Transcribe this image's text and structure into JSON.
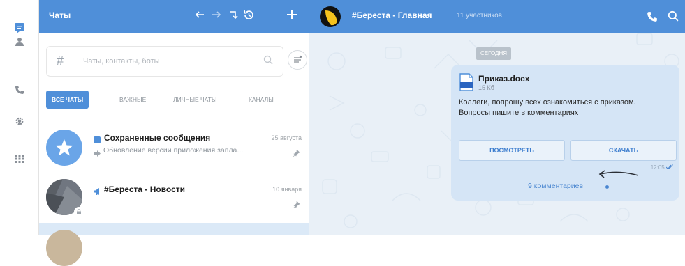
{
  "sidebar": {
    "icons": [
      "chat-icon",
      "user-icon",
      "phone-icon",
      "gear-icon",
      "apps-grid-icon"
    ]
  },
  "chats_panel": {
    "title": "Чаты",
    "search": {
      "hash": "#",
      "placeholder": "Чаты, контакты, боты"
    },
    "tabs": [
      {
        "label": "ВСЕ ЧАТЫ",
        "active": true
      },
      {
        "label": "ВАЖНЫЕ",
        "active": false
      },
      {
        "label": "ЛИЧНЫЕ ЧАТЫ",
        "active": false
      },
      {
        "label": "КАНАЛЫ",
        "active": false
      }
    ],
    "items": [
      {
        "name": "Сохраненные сообщения",
        "date": "25 августа",
        "preview": "Обновление версии приложения запла...",
        "pinned": true
      },
      {
        "name": "#Береста - Новости",
        "date": "10 января",
        "preview": "",
        "pinned": true
      }
    ]
  },
  "conversation": {
    "title": "#Береста - Главная",
    "members": "11 участников",
    "day_label": "СЕГОДНЯ",
    "message": {
      "file_name": "Приказ.docx",
      "file_size": "15 Кб",
      "text": "Коллеги, попрошу всех ознакомиться с приказом. Вопросы пишите в комментариях",
      "view_label": "ПОСМОТРЕТЬ",
      "download_label": "СКАЧАТЬ",
      "time": "12:05",
      "comments_label": "9 комментариев"
    }
  },
  "colors": {
    "accent": "#4f8fd9",
    "bubble": "#d5e5f6",
    "selected": "#dbe9f7"
  }
}
